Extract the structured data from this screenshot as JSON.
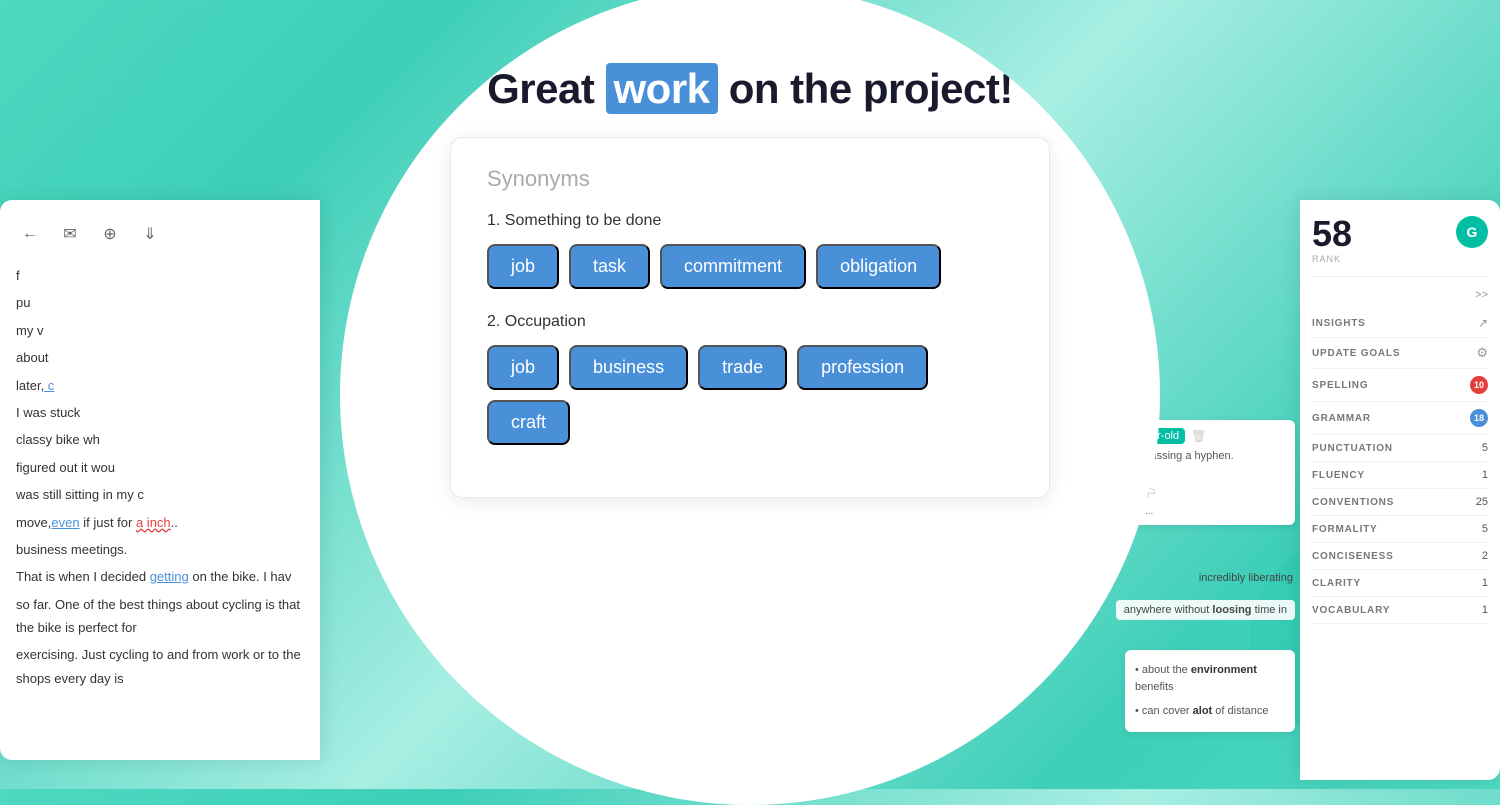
{
  "background": {
    "color_start": "#4dd9c0",
    "color_end": "#3ecfb8"
  },
  "heading": {
    "prefix": "Great ",
    "highlighted_word": "work",
    "suffix": " on the project!"
  },
  "synonyms_panel": {
    "title": "Synonyms",
    "groups": [
      {
        "number": "1",
        "label": "Something to be done",
        "tags": [
          "job",
          "task",
          "commitment",
          "obligation"
        ]
      },
      {
        "number": "2",
        "label": "Occupation",
        "tags": [
          "job",
          "business",
          "trade",
          "profession",
          "craft"
        ]
      }
    ]
  },
  "left_panel": {
    "editor_lines": [
      "f",
      "pu",
      "my v",
      "about",
      "later, I c",
      "I was stuck",
      "classy bike wh",
      "figured out it wou",
      "was still sitting in my c",
      "move, even if just for a inch.",
      "business meetings.",
      "That is when I decided getting on the bike. I hav",
      "so far. One of the best things about cycling is that the bike is perfect for",
      "exercising. Just cycling to and from work or to the shops every day is"
    ]
  },
  "right_panel": {
    "score": "58",
    "score_label": "RANK",
    "grammarly_letter": "G",
    "nav_label": ">>",
    "insights_label": "INSIGHTS",
    "update_goals_label": "UPDATE GOALS",
    "issues": [
      {
        "label": "SPELLING",
        "count": "10",
        "badge": "red"
      },
      {
        "label": "GRAMMAR",
        "count": "18",
        "badge": "blue"
      },
      {
        "label": "PUNCTUATION",
        "count": "5",
        "badge": null
      },
      {
        "label": "FLUENCY",
        "count": "1",
        "badge": null
      },
      {
        "label": "CONVENTIONS",
        "count": "25",
        "badge": null
      },
      {
        "label": "FORMALITY",
        "count": "5",
        "badge": null
      },
      {
        "label": "CONCISENESS",
        "count": "2",
        "badge": null
      },
      {
        "label": "CLARITY",
        "count": "1",
        "badge": null
      },
      {
        "label": "VOCABULARY",
        "count": "1",
        "badge": null
      }
    ],
    "inline_notes": [
      "missing a hyphen.",
      ")."
    ],
    "bullet_items": [
      "about the environment benefits",
      "can cover alot of distance"
    ],
    "highlighted_label": "ar-old",
    "inline_text1": "missing a hyphen.",
    "inline_text2": "anywhere without loosing time in",
    "bottom_text": "incredibly liberating"
  }
}
